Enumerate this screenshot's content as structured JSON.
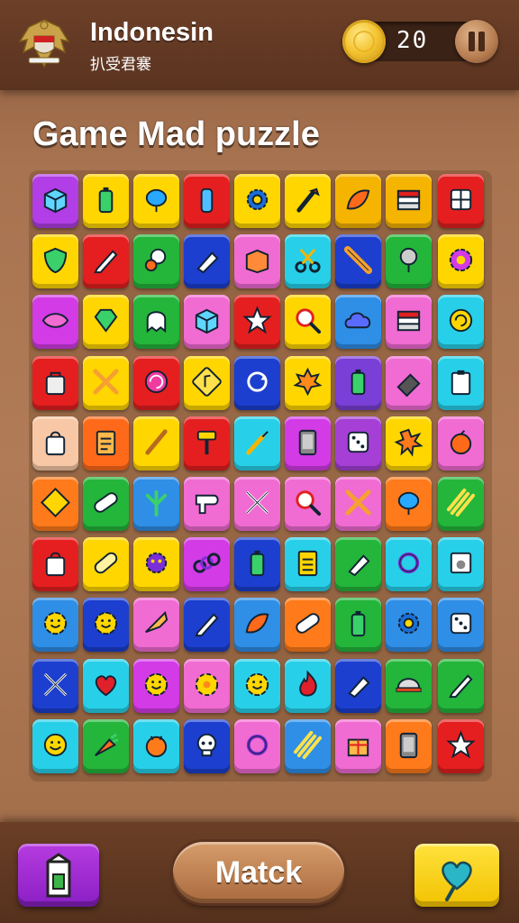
{
  "header": {
    "title": "Indonesin",
    "subtitle": "扒受君褰",
    "score": "20",
    "coin_icon": "gold-coin-icon",
    "pause_icon": "pause-icon",
    "emblem_icon": "garuda-emblem-icon"
  },
  "board": {
    "title": "Game Mad puzzle",
    "rows": [
      [
        {
          "color": "#b13ee6",
          "icon": "cube-icon"
        },
        {
          "color": "#ffd600",
          "icon": "battery-icon"
        },
        {
          "color": "#ffd600",
          "icon": "balloon-icon"
        },
        {
          "color": "#e51f1f",
          "icon": "bottle-icon"
        },
        {
          "color": "#ffd600",
          "icon": "gear-icon"
        },
        {
          "color": "#ffd600",
          "icon": "paintbrush-icon"
        },
        {
          "color": "#f5b400",
          "icon": "leaf-icon"
        },
        {
          "color": "#f5b400",
          "icon": "book-stack-icon"
        },
        {
          "color": "#e51f1f",
          "icon": "grid-icon"
        }
      ],
      [
        {
          "color": "#ffd600",
          "icon": "shield-icon"
        },
        {
          "color": "#e51f1f",
          "icon": "pencil-icon"
        },
        {
          "color": "#24b53b",
          "icon": "mushroom-icon"
        },
        {
          "color": "#1c3fcf",
          "icon": "marker-icon"
        },
        {
          "color": "#f06bd2",
          "icon": "box-icon"
        },
        {
          "color": "#27d0e8",
          "icon": "scissors-icon"
        },
        {
          "color": "#1c3fcf",
          "icon": "rolling-pin-icon"
        },
        {
          "color": "#24b53b",
          "icon": "pushpin-icon"
        },
        {
          "color": "#ffd600",
          "icon": "flower-gear-icon"
        }
      ],
      [
        {
          "color": "#d23be6",
          "icon": "lips-icon"
        },
        {
          "color": "#ffd600",
          "icon": "gem-icon"
        },
        {
          "color": "#24b53b",
          "icon": "ghost-icon"
        },
        {
          "color": "#f06bd2",
          "icon": "cube-icon"
        },
        {
          "color": "#e51f1f",
          "icon": "star-icon"
        },
        {
          "color": "#ffd600",
          "icon": "magnifier-icon"
        },
        {
          "color": "#2f8ee6",
          "icon": "cloud-icon"
        },
        {
          "color": "#f06bd2",
          "icon": "book-stack-icon"
        },
        {
          "color": "#27d0e8",
          "icon": "swirl-icon"
        }
      ],
      [
        {
          "color": "#e51f1f",
          "icon": "bag-icon"
        },
        {
          "color": "#ffd600",
          "icon": "crossed-sticks-icon"
        },
        {
          "color": "#e51f1f",
          "icon": "candy-icon"
        },
        {
          "color": "#ffd600",
          "icon": "music-note-icon"
        },
        {
          "color": "#1c3fcf",
          "icon": "refresh-icon"
        },
        {
          "color": "#ffd600",
          "icon": "maple-leaf-icon"
        },
        {
          "color": "#7a3fd6",
          "icon": "battery-icon"
        },
        {
          "color": "#f06bd2",
          "icon": "eraser-icon"
        },
        {
          "color": "#27d0e8",
          "icon": "clipboard-icon"
        }
      ],
      [
        {
          "color": "#f7c7a6",
          "icon": "shopping-bag-icon"
        },
        {
          "color": "#ff6a1a",
          "icon": "notepad-icon"
        },
        {
          "color": "#ffd600",
          "icon": "stick-icon"
        },
        {
          "color": "#e51f1f",
          "icon": "hammer-icon"
        },
        {
          "color": "#27d0e8",
          "icon": "screwdriver-icon"
        },
        {
          "color": "#d23be6",
          "icon": "phone-icon"
        },
        {
          "color": "#a53fd6",
          "icon": "dice-icon"
        },
        {
          "color": "#ffd600",
          "icon": "splat-icon"
        },
        {
          "color": "#f06bd2",
          "icon": "orange-icon"
        }
      ],
      [
        {
          "color": "#ff7a1a",
          "icon": "diamond-sign-icon"
        },
        {
          "color": "#24b53b",
          "icon": "capsule-icon"
        },
        {
          "color": "#2f8ee6",
          "icon": "plant-icon"
        },
        {
          "color": "#f06bd2",
          "icon": "hair-dryer-icon"
        },
        {
          "color": "#f06bd2",
          "icon": "crossed-swords-icon"
        },
        {
          "color": "#f06bd2",
          "icon": "magnifier-icon"
        },
        {
          "color": "#f06bd2",
          "icon": "crossed-sticks-icon"
        },
        {
          "color": "#ff7a1a",
          "icon": "balloon-icon"
        },
        {
          "color": "#24b53b",
          "icon": "bamboo-icon"
        }
      ],
      [
        {
          "color": "#e51f1f",
          "icon": "shopping-bag-icon"
        },
        {
          "color": "#ffd600",
          "icon": "pill-icon"
        },
        {
          "color": "#ffd600",
          "icon": "germ-icon"
        },
        {
          "color": "#d23be6",
          "icon": "links-icon"
        },
        {
          "color": "#1c3fcf",
          "icon": "battery-icon"
        },
        {
          "color": "#27d0e8",
          "icon": "calculator-icon"
        },
        {
          "color": "#24b53b",
          "icon": "marker-icon"
        },
        {
          "color": "#27d0e8",
          "icon": "ring-icon"
        },
        {
          "color": "#27d0e8",
          "icon": "photo-icon"
        }
      ],
      [
        {
          "color": "#2f8ee6",
          "icon": "smile-flower-icon"
        },
        {
          "color": "#1c3fcf",
          "icon": "smile-flower-icon"
        },
        {
          "color": "#f06bd2",
          "icon": "trumpet-icon"
        },
        {
          "color": "#1c3fcf",
          "icon": "pencil-icon"
        },
        {
          "color": "#2f8ee6",
          "icon": "leaf-icon"
        },
        {
          "color": "#ff7a1a",
          "icon": "capsule-icon"
        },
        {
          "color": "#24b53b",
          "icon": "battery-icon"
        },
        {
          "color": "#2f8ee6",
          "icon": "gear-icon"
        },
        {
          "color": "#2f8ee6",
          "icon": "dice-icon"
        }
      ],
      [
        {
          "color": "#1c3fcf",
          "icon": "crossed-swords-icon"
        },
        {
          "color": "#27d0e8",
          "icon": "heart-icon"
        },
        {
          "color": "#d23be6",
          "icon": "smile-flower-icon"
        },
        {
          "color": "#f06bd2",
          "icon": "flower-icon"
        },
        {
          "color": "#27d0e8",
          "icon": "smile-flower-icon"
        },
        {
          "color": "#27d0e8",
          "icon": "flame-icon"
        },
        {
          "color": "#1c3fcf",
          "icon": "marker-icon"
        },
        {
          "color": "#24b53b",
          "icon": "helmet-icon"
        },
        {
          "color": "#24b53b",
          "icon": "pencil-icon"
        }
      ],
      [
        {
          "color": "#27d0e8",
          "icon": "smiley-icon"
        },
        {
          "color": "#24b53b",
          "icon": "carrot-icon"
        },
        {
          "color": "#27d0e8",
          "icon": "bug-icon"
        },
        {
          "color": "#1c3fcf",
          "icon": "skull-icon"
        },
        {
          "color": "#f06bd2",
          "icon": "ring-icon"
        },
        {
          "color": "#2f8ee6",
          "icon": "bamboo-icon"
        },
        {
          "color": "#f06bd2",
          "icon": "gift-icon"
        },
        {
          "color": "#ff7a1a",
          "icon": "phone-icon"
        },
        {
          "color": "#e51f1f",
          "icon": "star-icon"
        }
      ]
    ]
  },
  "footer": {
    "left_icon": "milk-carton-icon",
    "match_label": "Matck",
    "right_icon": "heart-wand-icon"
  }
}
